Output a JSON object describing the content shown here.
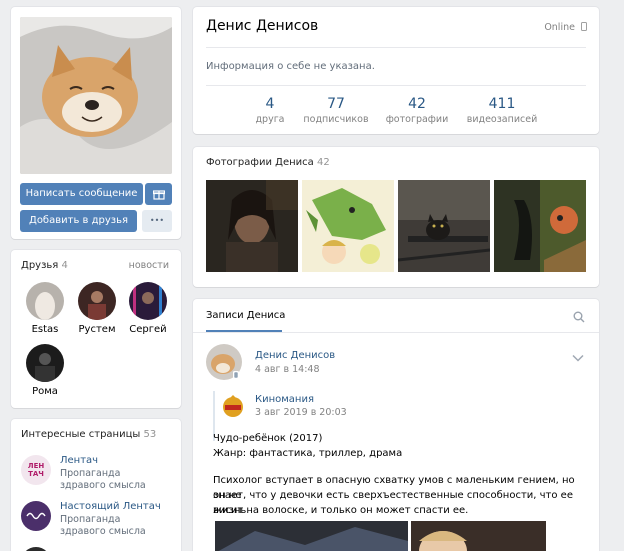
{
  "profile": {
    "name": "Денис Денисов",
    "status": "Online",
    "about": "Информация о себе не указана.",
    "stats": [
      {
        "value": "4",
        "label": "друга"
      },
      {
        "value": "77",
        "label": "подписчиков"
      },
      {
        "value": "42",
        "label": "фотографии"
      },
      {
        "value": "411",
        "label": "видеозаписей"
      }
    ]
  },
  "actions": {
    "message": "Написать сообщение",
    "add_friend": "Добавить в друзья",
    "more": "•••"
  },
  "friends": {
    "title": "Друзья",
    "count": "4",
    "news_link": "новости",
    "items": [
      {
        "name": "Estas"
      },
      {
        "name": "Рустем"
      },
      {
        "name": "Сергей"
      },
      {
        "name": "Рома"
      }
    ]
  },
  "interesting": {
    "title": "Интересные страницы",
    "count": "53",
    "items": [
      {
        "name": "Лентач",
        "desc": "Пропаганда здравого смысла"
      },
      {
        "name": "Настоящий Лентач",
        "desc": "Пропаганда здравого смысла"
      }
    ]
  },
  "photos": {
    "title": "Фотографии Дениса",
    "count": "42"
  },
  "wall": {
    "tab": "Записи Дениса",
    "post": {
      "author": "Денис Денисов",
      "date": "4 авг в 14:48",
      "repost": {
        "source": "Киномания",
        "date": "3 авг 2019 в 20:03",
        "line1": "Чудо-ребёнок (2017)",
        "line2": "Жанр: фантастика, триллер, драма",
        "body1": "Психолог вступает в опасную схватку умов с маленьким гением, но он не",
        "body2": "знает, что у девочки есть сверхъестественные способности, что ее жизнь",
        "body3": "висит на волоске, и только он может спасти ее."
      }
    }
  },
  "colors": {
    "accent": "#5181b8",
    "link": "#2a5885",
    "background": "#edeef0"
  }
}
